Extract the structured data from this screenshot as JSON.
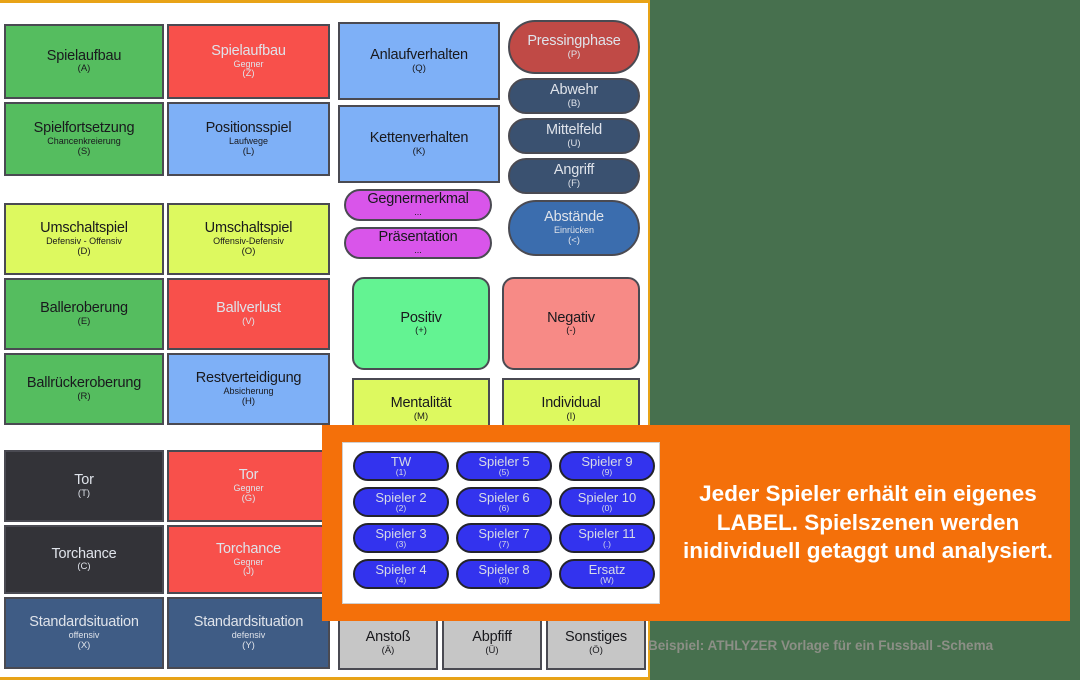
{
  "background_color": "#47704e",
  "accent_color": "#f4700a",
  "panel": {
    "border_color": "#e8a317",
    "groups": {
      "group_attack": [
        {
          "main": "Spielaufbau",
          "sub": "",
          "key": "(A)",
          "color": "#55bd5f"
        },
        {
          "main": "Spielaufbau",
          "sub": "Gegner",
          "key": "(Z)",
          "color": "#f8504b"
        },
        {
          "main": "Anlaufverhalten",
          "sub": "",
          "key": "(Q)",
          "color": "#7eb0f7"
        },
        {
          "main": "Spielfortsetzung",
          "sub": "Chancenkreierung",
          "key": "(S)",
          "color": "#55bd5f"
        },
        {
          "main": "Positionsspiel",
          "sub": "Laufwege",
          "key": "(L)",
          "color": "#7eb0f7"
        },
        {
          "main": "Kettenverhalten",
          "sub": "",
          "key": "(K)",
          "color": "#7eb0f7"
        }
      ],
      "group_transition": [
        {
          "main": "Umschaltspiel",
          "sub": "Defensiv - Offensiv",
          "key": "(D)",
          "color": "#ddf95f"
        },
        {
          "main": "Umschaltspiel",
          "sub": "Offensiv-Defensiv",
          "key": "(O)",
          "color": "#ddf95f"
        },
        {
          "main": "Balleroberung",
          "sub": "",
          "key": "(E)",
          "color": "#55bd5f"
        },
        {
          "main": "Ballverlust",
          "sub": "",
          "key": "(V)",
          "color": "#f8504b"
        },
        {
          "main": "Ballrückeroberung",
          "sub": "",
          "key": "(R)",
          "color": "#55bd5f"
        },
        {
          "main": "Restverteidigung",
          "sub": "Absicherung",
          "key": "(H)",
          "color": "#7eb0f7"
        }
      ],
      "group_goal": [
        {
          "main": "Tor",
          "sub": "",
          "key": "(T)",
          "color": "#333338"
        },
        {
          "main": "Tor",
          "sub": "Gegner",
          "key": "(G)",
          "color": "#f8504b"
        },
        {
          "main": "Torchance",
          "sub": "",
          "key": "(C)",
          "color": "#333338"
        },
        {
          "main": "Torchance",
          "sub": "Gegner",
          "key": "(J)",
          "color": "#f8504b"
        },
        {
          "main": "Standardsituation",
          "sub": "offensiv",
          "key": "(X)",
          "color": "#3f5c85"
        },
        {
          "main": "Standardsituation",
          "sub": "defensiv",
          "key": "(Y)",
          "color": "#3f5c85"
        }
      ],
      "group_phases": [
        {
          "main": "Pressingphase",
          "sub": "",
          "key": "(P)",
          "color": "#c04a46"
        },
        {
          "main": "Abwehr",
          "sub": "",
          "key": "(B)",
          "color": "#3a5170"
        },
        {
          "main": "Mittelfeld",
          "sub": "",
          "key": "(U)",
          "color": "#3a5170"
        },
        {
          "main": "Angriff",
          "sub": "",
          "key": "(F)",
          "color": "#3a5170"
        },
        {
          "main": "Abstände",
          "sub": "Einrücken",
          "key": "(<)",
          "color": "#3b6dae"
        }
      ],
      "group_opponent": [
        {
          "main": "Gegnermerkmal",
          "sub": "...",
          "key": "",
          "color": "#d955ea"
        },
        {
          "main": "Präsentation",
          "sub": "...",
          "key": "",
          "color": "#d955ea"
        }
      ],
      "group_rating": [
        {
          "main": "Positiv",
          "sub": "",
          "key": "(+)",
          "color": "#63f392"
        },
        {
          "main": "Negativ",
          "sub": "",
          "key": "(-)",
          "color": "#f78a86"
        },
        {
          "main": "Mentalität",
          "sub": "",
          "key": "(M)",
          "color": "#ddf95f"
        },
        {
          "main": "Individual",
          "sub": "",
          "key": "(I)",
          "color": "#ddf95f"
        }
      ],
      "group_misc": [
        {
          "main": "Anstoß",
          "sub": "",
          "key": "(Ä)",
          "color": "#c6c6c6"
        },
        {
          "main": "Abpfiff",
          "sub": "",
          "key": "(Ü)",
          "color": "#c6c6c6"
        },
        {
          "main": "Sonstiges",
          "sub": "",
          "key": "(Ö)",
          "color": "#c6c6c6"
        }
      ]
    }
  },
  "callout": {
    "background_color": "#f4700a",
    "text": "Jeder Spieler erhält ein eigenes LABEL. Spielszenen werden inidividuell getaggt und analysiert.",
    "players": [
      {
        "main": "TW",
        "key": "(1)"
      },
      {
        "main": "Spieler 5",
        "key": "(5)"
      },
      {
        "main": "Spieler 9",
        "key": "(9)"
      },
      {
        "main": "Spieler 2",
        "key": "(2)"
      },
      {
        "main": "Spieler 6",
        "key": "(6)"
      },
      {
        "main": "Spieler 10",
        "key": "(0)"
      },
      {
        "main": "Spieler 3",
        "key": "(3)"
      },
      {
        "main": "Spieler 7",
        "key": "(7)"
      },
      {
        "main": "Spieler 11",
        "key": "(.)"
      },
      {
        "main": "Spieler 4",
        "key": "(4)"
      },
      {
        "main": "Spieler 8",
        "key": "(8)"
      },
      {
        "main": "Ersatz",
        "key": "(W)"
      }
    ],
    "player_color": "#3333ee"
  },
  "caption": "Beispiel: ATHLYZER Vorlage für ein Fussball -Schema"
}
